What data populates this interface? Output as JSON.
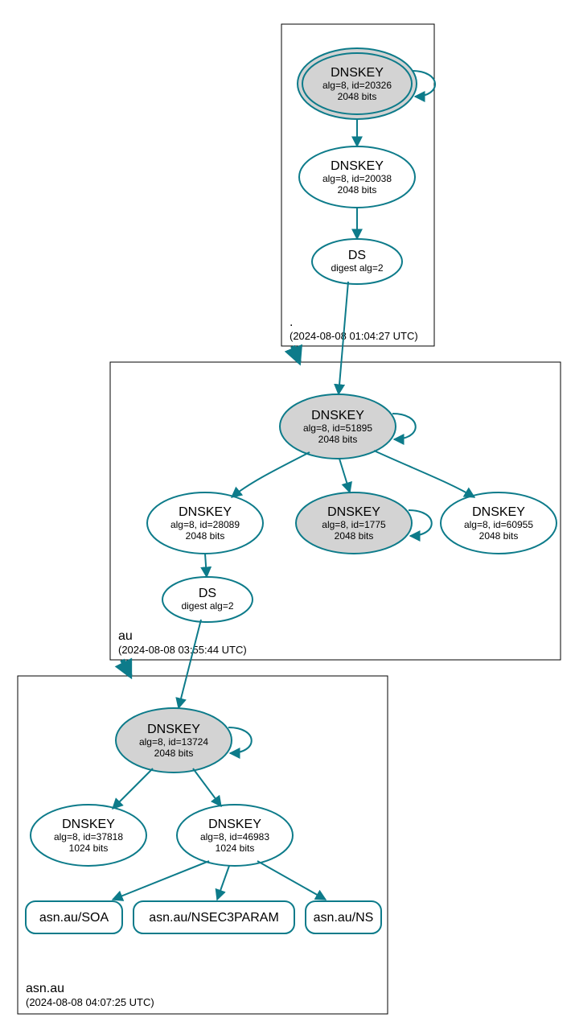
{
  "zones": {
    "root": {
      "label": ".",
      "timestamp": "(2024-08-08 01:04:27 UTC)"
    },
    "au": {
      "label": "au",
      "timestamp": "(2024-08-08 03:55:44 UTC)"
    },
    "asn": {
      "label": "asn.au",
      "timestamp": "(2024-08-08 04:07:25 UTC)"
    }
  },
  "nodes": {
    "root_ksk": {
      "title": "DNSKEY",
      "line2": "alg=8, id=20326",
      "line3": "2048 bits"
    },
    "root_zsk": {
      "title": "DNSKEY",
      "line2": "alg=8, id=20038",
      "line3": "2048 bits"
    },
    "root_ds": {
      "title": "DS",
      "line2": "digest alg=2"
    },
    "au_ksk": {
      "title": "DNSKEY",
      "line2": "alg=8, id=51895",
      "line3": "2048 bits"
    },
    "au_k1": {
      "title": "DNSKEY",
      "line2": "alg=8, id=28089",
      "line3": "2048 bits"
    },
    "au_k2": {
      "title": "DNSKEY",
      "line2": "alg=8, id=1775",
      "line3": "2048 bits"
    },
    "au_k3": {
      "title": "DNSKEY",
      "line2": "alg=8, id=60955",
      "line3": "2048 bits"
    },
    "au_ds": {
      "title": "DS",
      "line2": "digest alg=2"
    },
    "asn_ksk": {
      "title": "DNSKEY",
      "line2": "alg=8, id=13724",
      "line3": "2048 bits"
    },
    "asn_k1": {
      "title": "DNSKEY",
      "line2": "alg=8, id=37818",
      "line3": "1024 bits"
    },
    "asn_k2": {
      "title": "DNSKEY",
      "line2": "alg=8, id=46983",
      "line3": "1024 bits"
    },
    "asn_soa": {
      "title": "asn.au/SOA"
    },
    "asn_nsec": {
      "title": "asn.au/NSEC3PARAM"
    },
    "asn_ns": {
      "title": "asn.au/NS"
    }
  }
}
